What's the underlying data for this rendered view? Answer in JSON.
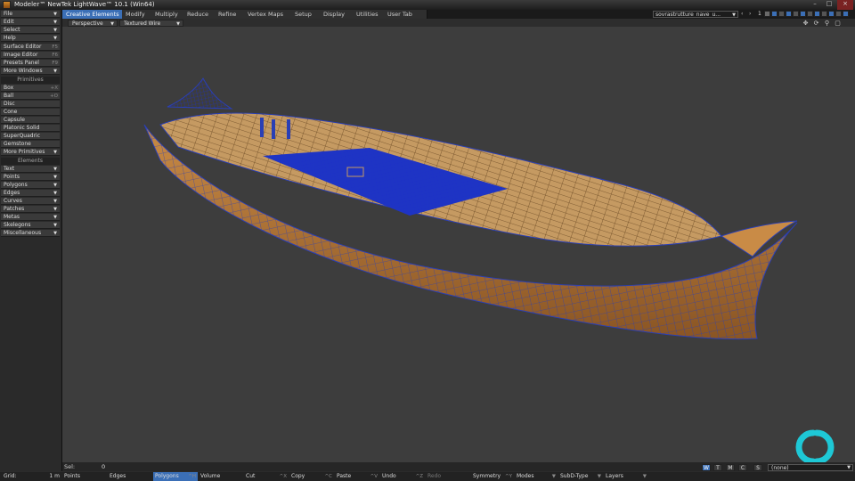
{
  "window": {
    "title": "Modeler™ NewTek LightWave™ 10.1 (Win64)"
  },
  "tabs": [
    {
      "label": "Creative Elements",
      "active": true
    },
    {
      "label": "Modify"
    },
    {
      "label": "Multiply"
    },
    {
      "label": "Reduce"
    },
    {
      "label": "Refine"
    },
    {
      "label": "Vertex Maps"
    },
    {
      "label": "Setup"
    },
    {
      "label": "Display"
    },
    {
      "label": "Utilities"
    },
    {
      "label": "User Tab"
    }
  ],
  "object_selector": {
    "value": "sovrastrutture_nave_u..."
  },
  "layer_number": "1",
  "viewport": {
    "view_mode": "Perspective",
    "render_mode": "Textured Wire"
  },
  "sidebar": {
    "menus": [
      {
        "label": "File"
      },
      {
        "label": "Edit"
      },
      {
        "label": "Select"
      },
      {
        "label": "Help"
      }
    ],
    "tools": [
      {
        "label": "Surface Editor",
        "shortcut": "F5"
      },
      {
        "label": "Image Editor",
        "shortcut": "F6"
      },
      {
        "label": "Presets Panel",
        "shortcut": "F9"
      },
      {
        "label": "More Windows"
      }
    ],
    "primitives_header": "Primitives",
    "primitives": [
      {
        "label": "Box",
        "shortcut": "+X"
      },
      {
        "label": "Ball",
        "shortcut": "+O"
      },
      {
        "label": "Disc"
      },
      {
        "label": "Cone"
      },
      {
        "label": "Capsule"
      },
      {
        "label": "Platonic Solid"
      },
      {
        "label": "SuperQuadric"
      },
      {
        "label": "Gemstone"
      },
      {
        "label": "More Primitives"
      }
    ],
    "elements_header": "Elements",
    "elements": [
      {
        "label": "Text"
      },
      {
        "label": "Points"
      },
      {
        "label": "Polygons"
      },
      {
        "label": "Edges"
      },
      {
        "label": "Curves"
      },
      {
        "label": "Patches"
      },
      {
        "label": "Metas"
      },
      {
        "label": "Skelegons"
      },
      {
        "label": "Miscellaneous"
      }
    ]
  },
  "status": {
    "sel_label": "Sel:",
    "sel_value": "0",
    "grid_label": "Grid:",
    "grid_value": "1 m",
    "view_toggles": [
      "W",
      "T",
      "M",
      "C",
      "S"
    ],
    "surface_value": "(none)"
  },
  "bottom": [
    {
      "label": "Points",
      "key": ""
    },
    {
      "label": "Edges",
      "key": ""
    },
    {
      "label": "Polygons",
      "key": "^H",
      "selected": true
    },
    {
      "label": "Volume",
      "key": ""
    },
    {
      "label": "Cut",
      "key": "^X"
    },
    {
      "label": "Copy",
      "key": "^C"
    },
    {
      "label": "Paste",
      "key": "^V"
    },
    {
      "label": "Undo",
      "key": "^Z"
    },
    {
      "label": "Redo",
      "key": ""
    },
    {
      "label": "Symmetry",
      "key": "^Y"
    },
    {
      "label": "Modes",
      "key": ""
    },
    {
      "label": "SubD-Type",
      "key": ""
    },
    {
      "label": "Layers",
      "key": ""
    }
  ],
  "colors": {
    "accent": "#3b6fb6",
    "wire": "#2a3fb5",
    "wood": "#b47838",
    "logo": "#1ec8d6"
  }
}
